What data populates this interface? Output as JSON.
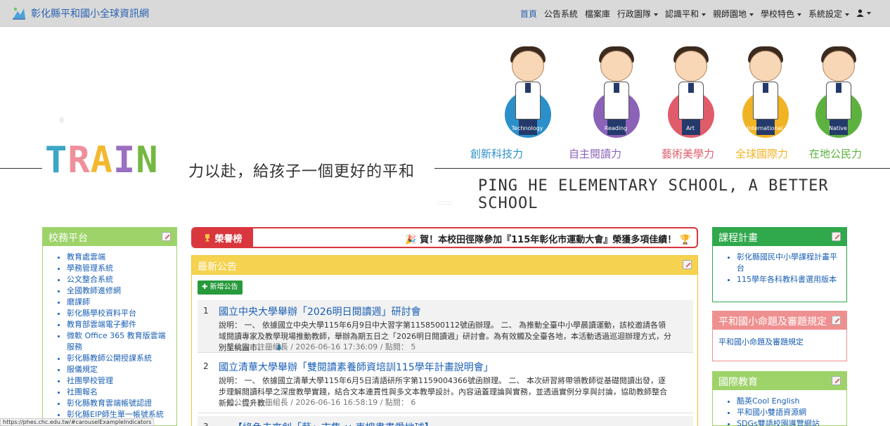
{
  "navbar": {
    "title": "彰化縣平和國小全球資訊網",
    "items": [
      {
        "label": "首頁",
        "dropdown": false,
        "active": true
      },
      {
        "label": "公告系統",
        "dropdown": false
      },
      {
        "label": "檔案庫",
        "dropdown": false
      },
      {
        "label": "行政園隊",
        "dropdown": true
      },
      {
        "label": "認識平和",
        "dropdown": true
      },
      {
        "label": "親師園地",
        "dropdown": true
      },
      {
        "label": "學校特色",
        "dropdown": true
      },
      {
        "label": "系統設定",
        "dropdown": true
      }
    ],
    "user_icon": "user-icon",
    "accent_color": "#2a62b0"
  },
  "banner": {
    "train": [
      "T",
      "R",
      "A",
      "I",
      "N"
    ],
    "train_colors": [
      "#3ba6c5",
      "#f08f9c",
      "#f4b830",
      "#9a6ec0",
      "#74b842"
    ],
    "tagline": "力以赴，給孩子一個更好的平和",
    "english": "PING HE ELEMENTARY SCHOOL, A BETTER SCHOOL",
    "themes": [
      {
        "label": "創新科技力",
        "tag": "Technology",
        "color": "#2b90c9"
      },
      {
        "label": "自主閱讀力",
        "tag": "Reading",
        "color": "#8b62b8"
      },
      {
        "label": "藝術美學力",
        "tag": "Art",
        "color": "#e05c6b"
      },
      {
        "label": "全球國際力",
        "tag": "International",
        "color": "#f0b324"
      },
      {
        "label": "在地公民力",
        "tag": "Native",
        "color": "#5db23f"
      }
    ]
  },
  "left_panel": {
    "title": "校務平台",
    "color": "#9ed36a",
    "items": [
      "教育處雲端",
      "學務管理系統",
      "公文整合系統",
      "全國教師進修網",
      "磨課師",
      "彰化縣學校資料平台",
      "教育部雲端電子郵件",
      "微軟 Office 365 教育版雲端服務",
      "彰化縣教師公開授課系統",
      "服儀規定",
      "社團學校管理",
      "社團報名",
      "彰化縣教育雲端帳號認證",
      "彰化縣EIP師生單一帳號系統"
    ]
  },
  "honor": {
    "label": "榮譽榜",
    "text": "賀！本校田徑隊參加『115年彰化市運動大會』榮獲多項佳績！"
  },
  "news": {
    "title": "最新公告",
    "add_button": "新增公告",
    "items": [
      {
        "no": "1",
        "title": "國立中央大學舉辦「2026明日閱讀週」研討會",
        "desc": "說明： 一、 依據國立中央大學115年6月9日中大習字第1158500112號函辦理。 二、 為推動全臺中小學晨讀運動，該校邀請各領域閱讀專家及教學現場推動教師，舉辦為期五日之「2026明日閱讀週」研討會。為有效觸及全臺各地，本活動透過巡迴辦理方式，分別至桃園市、...",
        "meta": "一般公告 / 註冊組長 / 2026-06-16 17:36:09 / 點閱： 5"
      },
      {
        "no": "2",
        "title": "國立清華大學舉辦「雙閱讀素養師資培訓115學年計畫說明會」",
        "desc": "說明： 一、 依據國立清華大學115年6月5日清語研所字第1159004366號函辦理。 二、 本次研習將帶領教師從基礎閱讀出發，逐步理解閱讀科學之深度教學實踐，結合文本連貫性與多文本教學設計。內容涵蓋理論與實務，並透過實例分享與討論，協助教師整合新知、提升教...",
        "meta": "一般公告 / 註冊組長 / 2026-06-16 16:58:19 / 點閱： 6"
      },
      {
        "no": "3",
        "title": "【綠色未來創「藝」市集 × 束搜書畫愛地球】",
        "desc": "",
        "meta": ""
      }
    ]
  },
  "right_panels": [
    {
      "title": "課程計畫",
      "color": "#30a84c",
      "items": [
        "彰化縣國民中小學課程計畫平台",
        "115學年各科教科書選用版本"
      ]
    },
    {
      "title": "平和國小命題及審題規定",
      "color": "#ef9090",
      "plain": "平和國小命題及審題規定"
    },
    {
      "title": "國際教育",
      "color": "#9ed36a",
      "items": [
        "酷英Cool English",
        "平和國小雙語資源網",
        "SDGs雙語校園導覽網站"
      ]
    }
  ],
  "statusbar": "https://phes.chc.edu.tw/#carouselExampleIndicators"
}
